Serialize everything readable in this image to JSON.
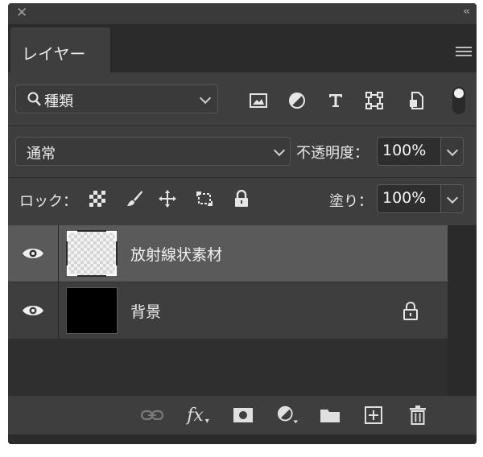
{
  "panel": {
    "close_icon": "close-icon",
    "collapse_icon": "double-chevron-left-icon"
  },
  "tabs": [
    {
      "label": "レイヤー"
    }
  ],
  "filter": {
    "kind_label": "種類",
    "icons": [
      "image-filter-icon",
      "adjustment-filter-icon",
      "type-filter-icon",
      "shape-filter-icon",
      "smart-object-filter-icon"
    ]
  },
  "blend": {
    "mode": "通常",
    "opacity_label": "不透明度：",
    "opacity_value": "100%"
  },
  "lock": {
    "label": "ロック：",
    "icons": [
      "lock-transparent-pixels-icon",
      "lock-image-pixels-icon",
      "lock-position-icon",
      "lock-artboard-icon",
      "lock-all-icon"
    ],
    "fill_label": "塗り：",
    "fill_value": "100%"
  },
  "layers": [
    {
      "name": "放射線状素材",
      "visible": true,
      "selected": true,
      "locked": false,
      "thumbnail": "transparent"
    },
    {
      "name": "背景",
      "visible": true,
      "selected": false,
      "locked": true,
      "thumbnail": "black"
    }
  ],
  "footer_icons": [
    "link-layers-icon",
    "fx-icon",
    "add-mask-icon",
    "new-fill-adjustment-icon",
    "new-group-icon",
    "new-layer-icon",
    "delete-layer-icon"
  ],
  "footer_text": {
    "fx": "fx"
  },
  "colors": {
    "panel_bg": "#3e3e3e",
    "selected_row": "#5a5a5a",
    "layer_area": "#2f2f2f"
  }
}
